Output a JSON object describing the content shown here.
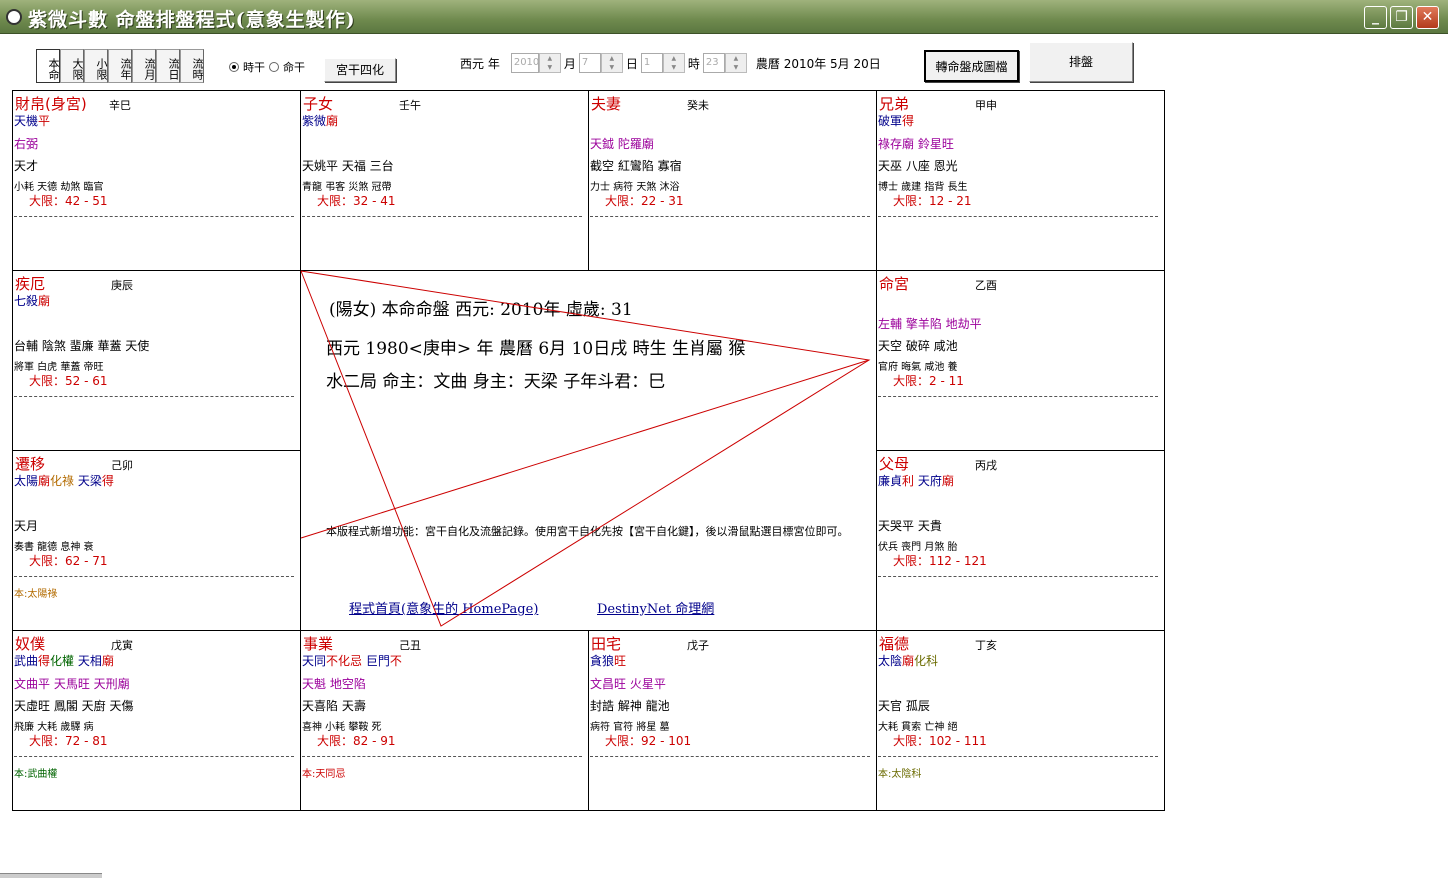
{
  "window": {
    "title": "紫微斗數  命盤排盤程式(意象生製作)"
  },
  "toolbar": {
    "vtabs": [
      "本命",
      "大限",
      "小限",
      "流年",
      "流月",
      "流日",
      "流時"
    ],
    "radio_shigan": "時干",
    "radio_minggan": "命干",
    "gong_sihua": "宮干四化",
    "xiyuan_label": "西元 年",
    "year_value": "2010",
    "month_label": "月",
    "month_value": "7",
    "day_label": "日",
    "day_value": "1",
    "hour_label": "時",
    "hour_value": "23",
    "lunar_text": "農曆  2010年  5月  20日",
    "convert_button": "轉命盤成圖檔",
    "paipan_button": "排盤"
  },
  "palaces": {
    "caibo": {
      "name": "財帛(身宮)",
      "gz": "辛巳",
      "main": [
        {
          "t": "天機",
          "c": "blue"
        },
        {
          "t": "平",
          "c": "red"
        }
      ],
      "minor": "右弼",
      "misc": "天才",
      "gods": "小耗   天德   劫煞              臨官",
      "daxian": "大限：42 -  51",
      "note": ""
    },
    "zinv": {
      "name": "子女",
      "gz": "壬午",
      "main": [
        {
          "t": "紫微",
          "c": "blue"
        },
        {
          "t": "廟",
          "c": "red"
        }
      ],
      "minor": "",
      "misc": "天姚平  天福  三台",
      "gods": "青龍   弔客   災煞              冠帶",
      "daxian": "大限：32 -  41",
      "note": ""
    },
    "fuqi": {
      "name": "夫妻",
      "gz": "癸未",
      "main": [],
      "minor": "天鉞  陀羅廟",
      "misc": "截空  紅鸞陷  寡宿",
      "gods": "力士   病符   天煞              沐浴",
      "daxian": "大限：22 -  31",
      "note": ""
    },
    "xiongdi": {
      "name": "兄弟",
      "gz": "甲申",
      "main": [
        {
          "t": "破軍",
          "c": "blue"
        },
        {
          "t": "得",
          "c": "red"
        }
      ],
      "minor": "祿存廟  鈴星旺",
      "misc": "天巫  八座  恩光",
      "gods": "博士   歲建   指背              長生",
      "daxian": "大限：12 -  21",
      "note": ""
    },
    "jie": {
      "name": "疾厄",
      "gz": "庚辰",
      "main": [
        {
          "t": "七殺",
          "c": "blue"
        },
        {
          "t": "廟",
          "c": "red"
        }
      ],
      "minor": "",
      "misc": "台輔  陰煞  蜚廉  華蓋  天使",
      "gods": "將軍   白虎   華蓋              帝旺",
      "daxian": "大限：52 -  61",
      "note": ""
    },
    "ming": {
      "name": "命宮",
      "gz": "乙酉",
      "main": [],
      "minor": "左輔  擎羊陷  地劫平",
      "misc": "天空  破碎  咸池",
      "gods": "官府   晦氣   咸池              養",
      "daxian": "大限：2 -  11",
      "note": ""
    },
    "qianyi": {
      "name": "遷移",
      "gz": "己卯",
      "main": [
        {
          "t": "太陽",
          "c": "blue"
        },
        {
          "t": "廟",
          "c": "red"
        },
        {
          "t": "化祿",
          "c": "orange"
        },
        {
          "t": "  天梁",
          "c": "blue"
        },
        {
          "t": "得",
          "c": "red"
        }
      ],
      "minor": "",
      "misc": "天月",
      "gods": "奏書   龍德   息神              衰",
      "daxian": "大限：62 -  71",
      "note": "本:太陽祿"
    },
    "fumu": {
      "name": "父母",
      "gz": "丙戌",
      "main": [
        {
          "t": "廉貞",
          "c": "blue"
        },
        {
          "t": "利",
          "c": "red"
        },
        {
          "t": "  天府",
          "c": "blue"
        },
        {
          "t": "廟",
          "c": "red"
        }
      ],
      "minor": "",
      "misc": "天哭平  天貴",
      "gods": "伏兵   喪門   月煞              胎",
      "daxian": "大限：112 -  121",
      "note": ""
    },
    "nupu": {
      "name": "奴僕",
      "gz": "戊寅",
      "main": [
        {
          "t": "武曲",
          "c": "blue"
        },
        {
          "t": "得",
          "c": "red"
        },
        {
          "t": "化權",
          "c": "green"
        },
        {
          "t": "  天相",
          "c": "blue"
        },
        {
          "t": "廟",
          "c": "red"
        }
      ],
      "minor": "文曲平  天馬旺  天刑廟",
      "misc": "天虛旺  鳳閣  天廚  天傷",
      "gods": "飛廉   大耗   歲驛              病",
      "daxian": "大限：72 -  81",
      "note": "本:武曲權"
    },
    "shiye": {
      "name": "事業",
      "gz": "己丑",
      "main": [
        {
          "t": "天同",
          "c": "blue"
        },
        {
          "t": "不",
          "c": "red"
        },
        {
          "t": "化忌",
          "c": "red"
        },
        {
          "t": "  巨門",
          "c": "blue"
        },
        {
          "t": "不",
          "c": "red"
        }
      ],
      "minor": "天魁  地空陷",
      "misc": "天喜陷  天壽",
      "gods": "喜神   小耗   攀鞍              死",
      "daxian": "大限：82 -  91",
      "note": "本:天同忌"
    },
    "tianzhai": {
      "name": "田宅",
      "gz": "戊子",
      "main": [
        {
          "t": "貪狼",
          "c": "blue"
        },
        {
          "t": "旺",
          "c": "red"
        }
      ],
      "minor": "文昌旺  火星平",
      "misc": "封誥  解神  龍池",
      "gods": "病符   官符   將星              墓",
      "daxian": "大限：92 -  101",
      "note": ""
    },
    "fude": {
      "name": "福德",
      "gz": "丁亥",
      "main": [
        {
          "t": "太陰",
          "c": "blue"
        },
        {
          "t": "廟",
          "c": "red"
        },
        {
          "t": "化科",
          "c": "olive"
        }
      ],
      "minor": "",
      "misc": "天官  孤辰",
      "gods": "大耗   貫索   亡神              絕",
      "daxian": "大限：102 -  111",
      "note": "本:太陰科"
    }
  },
  "center": {
    "line1": "(陽女)  本命命盤   西元: 2010年   虛歲: 31",
    "line2": "西元 1980<庚申> 年 農曆 6月 10日戌 時生   生肖屬 猴",
    "line3": "水二局    命主：文曲    身主：天梁    子年斗君：巳",
    "note": "本版程式新增功能：宮干自化及流盤記錄。使用宮干自化先按【宮干自化鍵】，後以滑鼠點選目標宮位即可。",
    "link1": "程式首頁(意象生的 HomePage)",
    "link2": "DestinyNet 命理網"
  },
  "colors": {
    "palace_name": "#cc0000",
    "star_main": "#00008b",
    "star_minor": "#9b009b",
    "lines": "#cc0000"
  }
}
